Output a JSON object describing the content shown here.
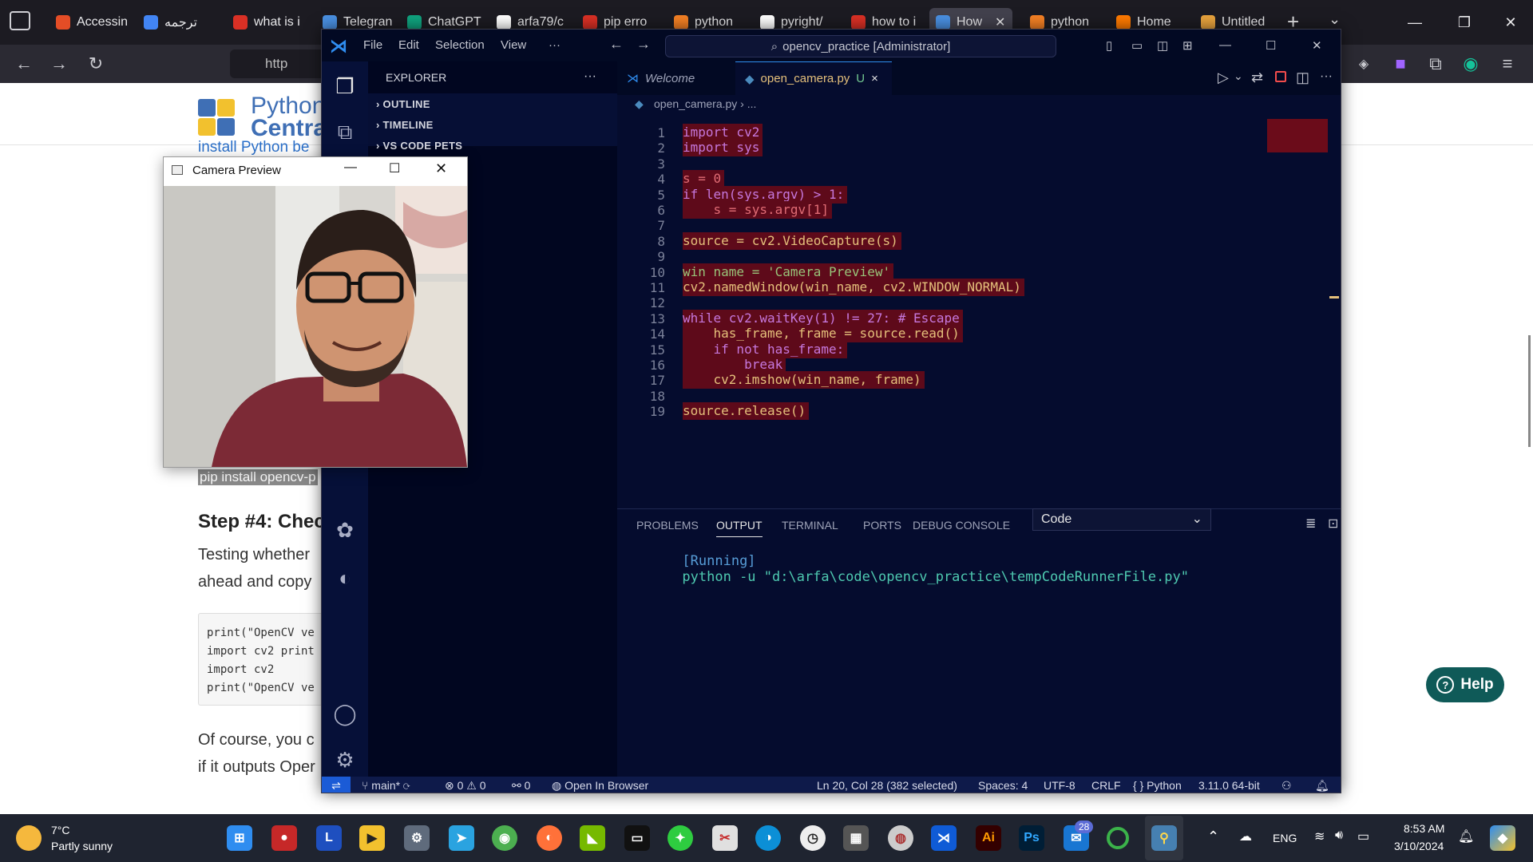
{
  "browser": {
    "tabs": [
      {
        "label": "Accessin",
        "color": "#e44d26"
      },
      {
        "label": "ترجمه",
        "color": "#4285f4"
      },
      {
        "label": "what is i",
        "color": "#d93025"
      },
      {
        "label": "Telegran",
        "color": "#4a90e2"
      },
      {
        "label": "ChatGPT",
        "color": "#10a37f"
      },
      {
        "label": "arfa79/c",
        "color": "#ffffff"
      },
      {
        "label": "pip erro",
        "color": "#d93025"
      },
      {
        "label": "python",
        "color": "#f48024"
      },
      {
        "label": "pyright/",
        "color": "#ffffff"
      },
      {
        "label": "how to i",
        "color": "#d93025"
      },
      {
        "label": "How",
        "color": "#4a90e2"
      },
      {
        "label": "python",
        "color": "#f48024"
      },
      {
        "label": "Home",
        "color": "#ff7a00"
      },
      {
        "label": "Untitled",
        "color": "#e8a33d"
      }
    ],
    "new_tab": "+",
    "url_text": "http"
  },
  "page": {
    "logo_line1": "Python",
    "logo_line2": "Centra",
    "link_text": "install Python be",
    "pip_text": "pip install opencv-p",
    "step_heading": "Step #4: Chec",
    "para1_line1": "Testing whether",
    "para1_line2": "ahead and copy",
    "code_lines": [
      "print(\"OpenCV ve",
      "import cv2 print",
      "import cv2",
      "print(\"OpenCV ve"
    ],
    "para2_line1": "Of course, you c",
    "para2_line2": "if it outputs Oper",
    "help_label": "Help"
  },
  "vscode": {
    "menu": [
      "File",
      "Edit",
      "Selection",
      "View",
      "···"
    ],
    "command_center": "opencv_practice [Administrator]",
    "explorer_title": "EXPLORER",
    "explorer_more": "···",
    "sidebar_sections": [
      "OUTLINE",
      "TIMELINE",
      "VS CODE PETS"
    ],
    "tabs": [
      {
        "label": "Welcome",
        "italic": true
      },
      {
        "label": "open_camera.py",
        "badge": "U",
        "close": "×"
      }
    ],
    "breadcrumb": "open_camera.py › ...",
    "line_numbers": [
      "1",
      "2",
      "3",
      "4",
      "5",
      "6",
      "7",
      "8",
      "9",
      "10",
      "11",
      "12",
      "13",
      "14",
      "15",
      "16",
      "17",
      "18",
      "19"
    ],
    "code_text": {
      "l1": "import cv2",
      "l2": "import sys",
      "l4": "s = 0",
      "l5": "if len(sys.argv) > 1:",
      "l6": "    s = sys.argv[1]",
      "l8": "source = cv2.VideoCapture(s)",
      "l10": "win_name = 'Camera Preview'",
      "l11": "cv2.namedWindow(win_name, cv2.WINDOW_NORMAL)",
      "l13": "while cv2.waitKey(1) != 27: # Escape",
      "l14": "    has_frame, frame = source.read()",
      "l15": "    if not has_frame:",
      "l16": "        break",
      "l17": "    cv2.imshow(win_name, frame)",
      "l19": "source.release()"
    },
    "panel_tabs": [
      "PROBLEMS",
      "OUTPUT",
      "TERMINAL",
      "PORTS",
      "DEBUG CONSOLE"
    ],
    "panel_active": "OUTPUT",
    "output_channel": "Code",
    "output_line": {
      "tag": "[Running]",
      "cmd": "python -u \"d:\\arfa\\code\\opencv_practice\\tempCodeRunnerFile.py\""
    },
    "status": {
      "branch": "main*",
      "errors": "0",
      "warnings": "0",
      "ports": "0",
      "open_browser": "Open In Browser",
      "position": "Ln 20, Col 28 (382 selected)",
      "spaces": "Spaces: 4",
      "encoding": "UTF-8",
      "eol": "CRLF",
      "language": "Python",
      "interpreter": "3.11.0 64-bit"
    }
  },
  "camera_window": {
    "title": "Camera Preview"
  },
  "taskbar": {
    "weather_temp": "7°C",
    "weather_desc": "Partly sunny",
    "badge_count": "28",
    "language": "ENG",
    "time": "8:53 AM",
    "date": "3/10/2024"
  },
  "colors": {
    "accent_blue": "#1b5bd6",
    "selection_red": "#5e0a1a",
    "help_teal": "#0f5a58"
  }
}
